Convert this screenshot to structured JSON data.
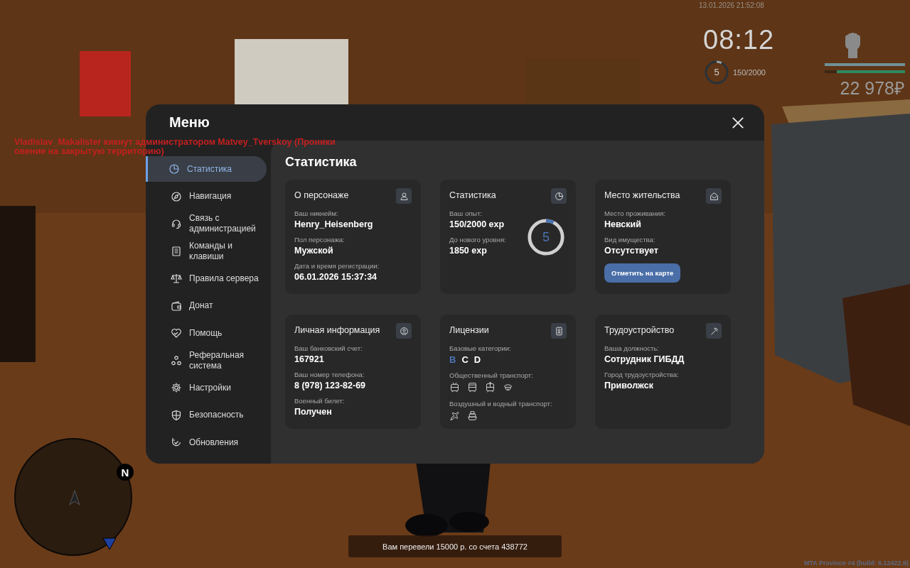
{
  "hud": {
    "datetime": "13.01.2026 21:52:08",
    "clock": "08:12",
    "level": "5",
    "exp": "150/2000",
    "exp_ring": {
      "level": 0.075
    },
    "bars": [
      {
        "level": 1
      },
      {
        "level": 0.85
      }
    ],
    "money": "22 978₽"
  },
  "chat": [
    "Vladislav_Makalister кикнут администратором Matvey_Tverskoy (Проники",
    "овение на закрытую территорию)"
  ],
  "menu": {
    "title": "Меню",
    "sidebar": [
      {
        "label": "Статистика",
        "selected": true
      },
      {
        "label": "Навигация",
        "selected": false
      },
      {
        "label": "Связь с администрацией",
        "selected": false
      },
      {
        "label": "Команды и клавиши",
        "selected": false
      },
      {
        "label": "Правила сервера",
        "selected": false
      },
      {
        "label": "Донат",
        "selected": false
      },
      {
        "label": "Помощь",
        "selected": false
      },
      {
        "label": "Реферальная система",
        "selected": false
      },
      {
        "label": "Настройки",
        "selected": false
      },
      {
        "label": "Безопасность",
        "selected": false
      },
      {
        "label": "Обновления",
        "selected": false
      }
    ],
    "page_title": "Статистика",
    "cards": [
      {
        "title": "О персонаже",
        "fields": [
          {
            "label": "Ваш никнейм:",
            "value": "Henry_Heisenberg"
          },
          {
            "label": "Пол персонажа:",
            "value": "Мужской"
          },
          {
            "label": "Дата и время регистрации:",
            "value": "06.01.2026 15:37:34"
          }
        ]
      },
      {
        "title": "Статистика",
        "fields": [
          {
            "label": "Ваш опыт:",
            "value": "150/2000 exp"
          },
          {
            "label": "До нового уровня:",
            "value": "1850 exp"
          }
        ],
        "ring": {
          "value": "5",
          "level": 0.075
        }
      },
      {
        "title": "Место жительства",
        "fields": [
          {
            "label": "Место проживания:",
            "value": "Невский"
          },
          {
            "label": "Вид имущества:",
            "value": "Отсутствует"
          }
        ],
        "button": "Отметить на карте"
      },
      {
        "title": "Личная информация",
        "fields": [
          {
            "label": "Ваш банковский счет:",
            "value": "167921"
          },
          {
            "label": "Ваш номер телефона:",
            "value": "8 (978) 123-82-69"
          },
          {
            "label": "Военный билет:",
            "value": "Получен"
          }
        ]
      },
      {
        "title": "Лицензии",
        "categories_label": "Базовые категории:",
        "categories": [
          {
            "label": "B",
            "selected": true
          },
          {
            "label": "C",
            "selected": false
          },
          {
            "label": "D",
            "selected": false
          }
        ],
        "groups": [
          {
            "label": "Общественный транспорт:",
            "vehicles": [
              {
                "kind": "trolleybus"
              },
              {
                "kind": "bus"
              },
              {
                "kind": "tram"
              },
              {
                "kind": "cap"
              }
            ]
          },
          {
            "label": "Воздушный и водный транспорт:",
            "vehicles": [
              {
                "kind": "plane"
              },
              {
                "kind": "boat"
              }
            ]
          }
        ]
      },
      {
        "title": "Трудоустройство",
        "fields": [
          {
            "label": "Ваша должность:",
            "value": "Сотрудник ГИБДД"
          },
          {
            "label": "Город трудоустройства:",
            "value": "Приволжск"
          }
        ]
      }
    ]
  },
  "minimap": {
    "north": "N"
  },
  "notification": "Вам перевели 15000 р. со счета 438772",
  "build": "MTA Province #4 (build: 6.12422.9)"
}
